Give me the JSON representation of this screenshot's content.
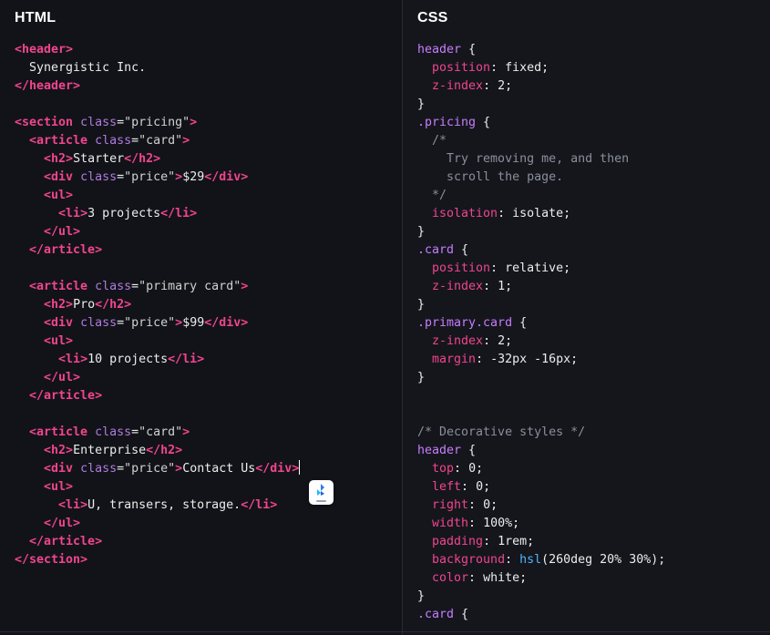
{
  "html_pane": {
    "title": "HTML",
    "lines": [
      [
        {
          "t": "tag",
          "v": "<header>"
        }
      ],
      [
        {
          "t": "txt",
          "v": "  Synergistic Inc."
        }
      ],
      [
        {
          "t": "tag",
          "v": "</header>"
        }
      ],
      [],
      [
        {
          "t": "tag",
          "v": "<section"
        },
        {
          "t": "txt",
          "v": " "
        },
        {
          "t": "attr",
          "v": "class"
        },
        {
          "t": "txt",
          "v": "="
        },
        {
          "t": "str",
          "v": "\"pricing\""
        },
        {
          "t": "tag",
          "v": ">"
        }
      ],
      [
        {
          "t": "txt",
          "v": "  "
        },
        {
          "t": "tag",
          "v": "<article"
        },
        {
          "t": "txt",
          "v": " "
        },
        {
          "t": "attr",
          "v": "class"
        },
        {
          "t": "txt",
          "v": "="
        },
        {
          "t": "str",
          "v": "\"card\""
        },
        {
          "t": "tag",
          "v": ">"
        }
      ],
      [
        {
          "t": "txt",
          "v": "    "
        },
        {
          "t": "tag",
          "v": "<h2>"
        },
        {
          "t": "txt",
          "v": "Starter"
        },
        {
          "t": "tag",
          "v": "</h2>"
        }
      ],
      [
        {
          "t": "txt",
          "v": "    "
        },
        {
          "t": "tag",
          "v": "<div"
        },
        {
          "t": "txt",
          "v": " "
        },
        {
          "t": "attr",
          "v": "class"
        },
        {
          "t": "txt",
          "v": "="
        },
        {
          "t": "str",
          "v": "\"price\""
        },
        {
          "t": "tag",
          "v": ">"
        },
        {
          "t": "txt",
          "v": "$29"
        },
        {
          "t": "tag",
          "v": "</div>"
        }
      ],
      [
        {
          "t": "txt",
          "v": "    "
        },
        {
          "t": "tag",
          "v": "<ul>"
        }
      ],
      [
        {
          "t": "txt",
          "v": "      "
        },
        {
          "t": "tag",
          "v": "<li>"
        },
        {
          "t": "txt",
          "v": "3 projects"
        },
        {
          "t": "tag",
          "v": "</li>"
        }
      ],
      [
        {
          "t": "txt",
          "v": "    "
        },
        {
          "t": "tag",
          "v": "</ul>"
        }
      ],
      [
        {
          "t": "txt",
          "v": "  "
        },
        {
          "t": "tag",
          "v": "</article>"
        }
      ],
      [],
      [
        {
          "t": "txt",
          "v": "  "
        },
        {
          "t": "tag",
          "v": "<article"
        },
        {
          "t": "txt",
          "v": " "
        },
        {
          "t": "attr",
          "v": "class"
        },
        {
          "t": "txt",
          "v": "="
        },
        {
          "t": "str",
          "v": "\"primary card\""
        },
        {
          "t": "tag",
          "v": ">"
        }
      ],
      [
        {
          "t": "txt",
          "v": "    "
        },
        {
          "t": "tag",
          "v": "<h2>"
        },
        {
          "t": "txt",
          "v": "Pro"
        },
        {
          "t": "tag",
          "v": "</h2>"
        }
      ],
      [
        {
          "t": "txt",
          "v": "    "
        },
        {
          "t": "tag",
          "v": "<div"
        },
        {
          "t": "txt",
          "v": " "
        },
        {
          "t": "attr",
          "v": "class"
        },
        {
          "t": "txt",
          "v": "="
        },
        {
          "t": "str",
          "v": "\"price\""
        },
        {
          "t": "tag",
          "v": ">"
        },
        {
          "t": "txt",
          "v": "$99"
        },
        {
          "t": "tag",
          "v": "</div>"
        }
      ],
      [
        {
          "t": "txt",
          "v": "    "
        },
        {
          "t": "tag",
          "v": "<ul>"
        }
      ],
      [
        {
          "t": "txt",
          "v": "      "
        },
        {
          "t": "tag",
          "v": "<li>"
        },
        {
          "t": "txt",
          "v": "10 projects"
        },
        {
          "t": "tag",
          "v": "</li>"
        }
      ],
      [
        {
          "t": "txt",
          "v": "    "
        },
        {
          "t": "tag",
          "v": "</ul>"
        }
      ],
      [
        {
          "t": "txt",
          "v": "  "
        },
        {
          "t": "tag",
          "v": "</article>"
        }
      ],
      [],
      [
        {
          "t": "txt",
          "v": "  "
        },
        {
          "t": "tag",
          "v": "<article"
        },
        {
          "t": "txt",
          "v": " "
        },
        {
          "t": "attr",
          "v": "class"
        },
        {
          "t": "txt",
          "v": "="
        },
        {
          "t": "str",
          "v": "\"card\""
        },
        {
          "t": "tag",
          "v": ">"
        }
      ],
      [
        {
          "t": "txt",
          "v": "    "
        },
        {
          "t": "tag",
          "v": "<h2>"
        },
        {
          "t": "txt",
          "v": "Enterprise"
        },
        {
          "t": "tag",
          "v": "</h2>"
        }
      ],
      [
        {
          "t": "txt",
          "v": "    "
        },
        {
          "t": "tag",
          "v": "<div"
        },
        {
          "t": "txt",
          "v": " "
        },
        {
          "t": "attr",
          "v": "class"
        },
        {
          "t": "txt",
          "v": "="
        },
        {
          "t": "str",
          "v": "\"price\""
        },
        {
          "t": "tag",
          "v": ">"
        },
        {
          "t": "txt",
          "v": "Contact Us"
        },
        {
          "t": "tag",
          "v": "</div>"
        },
        {
          "t": "cursor",
          "v": ""
        }
      ],
      [
        {
          "t": "txt",
          "v": "    "
        },
        {
          "t": "tag",
          "v": "<ul>"
        }
      ],
      [
        {
          "t": "txt",
          "v": "      "
        },
        {
          "t": "tag",
          "v": "<li>"
        },
        {
          "t": "txt",
          "v": "U, transers, storage."
        },
        {
          "t": "tag",
          "v": "</li>"
        }
      ],
      [
        {
          "t": "txt",
          "v": "    "
        },
        {
          "t": "tag",
          "v": "</ul>"
        }
      ],
      [
        {
          "t": "txt",
          "v": "  "
        },
        {
          "t": "tag",
          "v": "</article>"
        }
      ],
      [
        {
          "t": "tag",
          "v": "</section>"
        }
      ]
    ]
  },
  "css_pane": {
    "title": "CSS",
    "lines": [
      [
        {
          "t": "sel",
          "v": "header"
        },
        {
          "t": "pun",
          "v": " {"
        }
      ],
      [
        {
          "t": "pun",
          "v": "  "
        },
        {
          "t": "prop",
          "v": "position"
        },
        {
          "t": "pun",
          "v": ": "
        },
        {
          "t": "val",
          "v": "fixed"
        },
        {
          "t": "pun",
          "v": ";"
        }
      ],
      [
        {
          "t": "pun",
          "v": "  "
        },
        {
          "t": "prop",
          "v": "z-index"
        },
        {
          "t": "pun",
          "v": ": "
        },
        {
          "t": "val",
          "v": "2"
        },
        {
          "t": "pun",
          "v": ";"
        }
      ],
      [
        {
          "t": "pun",
          "v": "}"
        }
      ],
      [
        {
          "t": "sel",
          "v": ".pricing"
        },
        {
          "t": "pun",
          "v": " {"
        }
      ],
      [
        {
          "t": "cmt",
          "v": "  /*"
        }
      ],
      [
        {
          "t": "cmt",
          "v": "    Try removing me, and then"
        }
      ],
      [
        {
          "t": "cmt",
          "v": "    scroll the page."
        }
      ],
      [
        {
          "t": "cmt",
          "v": "  */"
        }
      ],
      [
        {
          "t": "pun",
          "v": "  "
        },
        {
          "t": "prop",
          "v": "isolation"
        },
        {
          "t": "pun",
          "v": ": "
        },
        {
          "t": "val",
          "v": "isolate"
        },
        {
          "t": "pun",
          "v": ";"
        }
      ],
      [
        {
          "t": "pun",
          "v": "}"
        }
      ],
      [
        {
          "t": "sel",
          "v": ".card"
        },
        {
          "t": "pun",
          "v": " {"
        }
      ],
      [
        {
          "t": "pun",
          "v": "  "
        },
        {
          "t": "prop",
          "v": "position"
        },
        {
          "t": "pun",
          "v": ": "
        },
        {
          "t": "val",
          "v": "relative"
        },
        {
          "t": "pun",
          "v": ";"
        }
      ],
      [
        {
          "t": "pun",
          "v": "  "
        },
        {
          "t": "prop",
          "v": "z-index"
        },
        {
          "t": "pun",
          "v": ": "
        },
        {
          "t": "val",
          "v": "1"
        },
        {
          "t": "pun",
          "v": ";"
        }
      ],
      [
        {
          "t": "pun",
          "v": "}"
        }
      ],
      [
        {
          "t": "sel",
          "v": ".primary.card"
        },
        {
          "t": "pun",
          "v": " {"
        }
      ],
      [
        {
          "t": "pun",
          "v": "  "
        },
        {
          "t": "prop",
          "v": "z-index"
        },
        {
          "t": "pun",
          "v": ": "
        },
        {
          "t": "val",
          "v": "2"
        },
        {
          "t": "pun",
          "v": ";"
        }
      ],
      [
        {
          "t": "pun",
          "v": "  "
        },
        {
          "t": "prop",
          "v": "margin"
        },
        {
          "t": "pun",
          "v": ": "
        },
        {
          "t": "val",
          "v": "-32px -16px"
        },
        {
          "t": "pun",
          "v": ";"
        }
      ],
      [
        {
          "t": "pun",
          "v": "}"
        }
      ],
      [],
      [],
      [
        {
          "t": "cmt",
          "v": "/* Decorative styles */"
        }
      ],
      [
        {
          "t": "sel",
          "v": "header"
        },
        {
          "t": "pun",
          "v": " {"
        }
      ],
      [
        {
          "t": "pun",
          "v": "  "
        },
        {
          "t": "prop",
          "v": "top"
        },
        {
          "t": "pun",
          "v": ": "
        },
        {
          "t": "val",
          "v": "0"
        },
        {
          "t": "pun",
          "v": ";"
        }
      ],
      [
        {
          "t": "pun",
          "v": "  "
        },
        {
          "t": "prop",
          "v": "left"
        },
        {
          "t": "pun",
          "v": ": "
        },
        {
          "t": "val",
          "v": "0"
        },
        {
          "t": "pun",
          "v": ";"
        }
      ],
      [
        {
          "t": "pun",
          "v": "  "
        },
        {
          "t": "prop",
          "v": "right"
        },
        {
          "t": "pun",
          "v": ": "
        },
        {
          "t": "val",
          "v": "0"
        },
        {
          "t": "pun",
          "v": ";"
        }
      ],
      [
        {
          "t": "pun",
          "v": "  "
        },
        {
          "t": "prop",
          "v": "width"
        },
        {
          "t": "pun",
          "v": ": "
        },
        {
          "t": "val",
          "v": "100%"
        },
        {
          "t": "pun",
          "v": ";"
        }
      ],
      [
        {
          "t": "pun",
          "v": "  "
        },
        {
          "t": "prop",
          "v": "padding"
        },
        {
          "t": "pun",
          "v": ": "
        },
        {
          "t": "val",
          "v": "1rem"
        },
        {
          "t": "pun",
          "v": ";"
        }
      ],
      [
        {
          "t": "pun",
          "v": "  "
        },
        {
          "t": "prop",
          "v": "background"
        },
        {
          "t": "pun",
          "v": ": "
        },
        {
          "t": "fn",
          "v": "hsl"
        },
        {
          "t": "val",
          "v": "(260deg 20% 30%)"
        },
        {
          "t": "pun",
          "v": ";"
        }
      ],
      [
        {
          "t": "pun",
          "v": "  "
        },
        {
          "t": "prop",
          "v": "color"
        },
        {
          "t": "pun",
          "v": ": "
        },
        {
          "t": "val",
          "v": "white"
        },
        {
          "t": "pun",
          "v": ";"
        }
      ],
      [
        {
          "t": "pun",
          "v": "}"
        }
      ],
      [
        {
          "t": "sel",
          "v": ".card"
        },
        {
          "t": "pun",
          "v": " {"
        }
      ]
    ]
  },
  "floating_logo": {
    "icon": "app-logo-icon"
  },
  "colors": {
    "background": "#121318",
    "tag": "#f0458f",
    "attribute": "#b07ae0",
    "selector": "#c77dff",
    "function": "#4fb3ff",
    "comment": "#8a8f9c",
    "text": "#ececec"
  }
}
